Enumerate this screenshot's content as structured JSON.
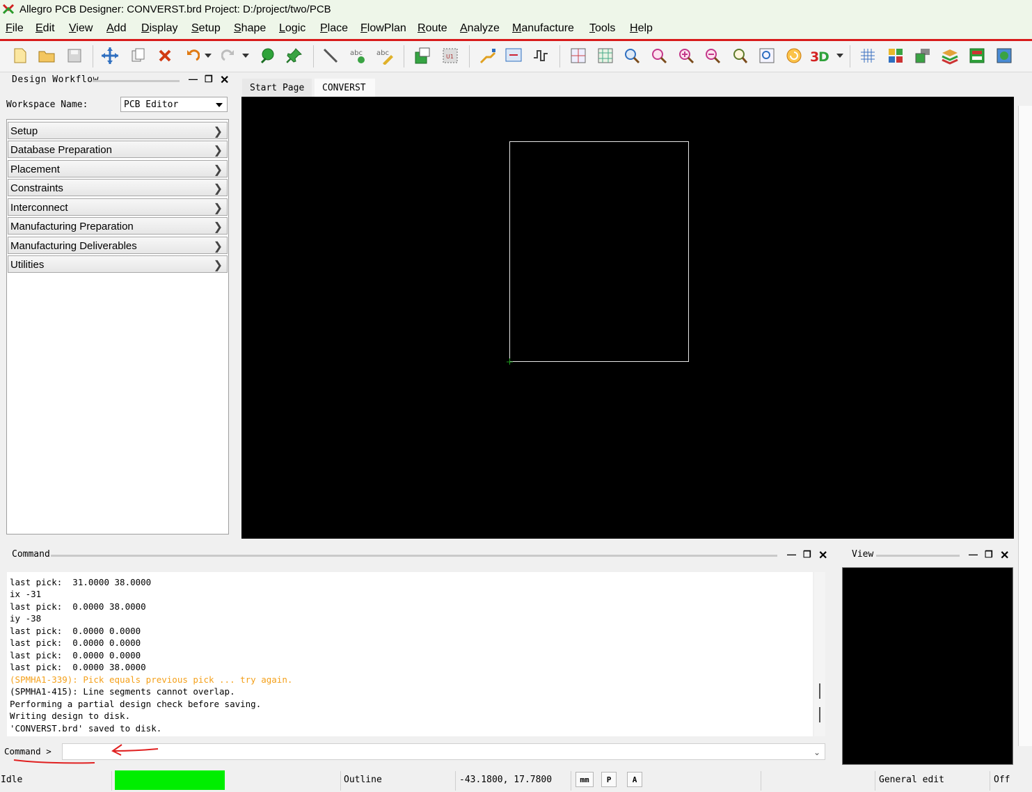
{
  "window": {
    "title": "Allegro PCB Designer: CONVERST.brd  Project: D:/project/two/PCB"
  },
  "menu": [
    "File",
    "Edit",
    "View",
    "Add",
    "Display",
    "Setup",
    "Shape",
    "Logic",
    "Place",
    "FlowPlan",
    "Route",
    "Analyze",
    "Manufacture",
    "Tools",
    "Help"
  ],
  "workflow": {
    "title": "Design Workflow",
    "workspace_label": "Workspace Name:",
    "workspace_value": "PCB Editor",
    "items": [
      "Setup",
      "Database Preparation",
      "Placement",
      "Constraints",
      "Interconnect",
      "Manufacturing Preparation",
      "Manufacturing Deliverables",
      "Utilities"
    ]
  },
  "tabs": [
    "Start Page",
    "CONVERST"
  ],
  "command": {
    "title": "Command",
    "lines": [
      {
        "text": "last pick:  31.0000 38.0000",
        "type": "normal"
      },
      {
        "text": "ix -31",
        "type": "normal"
      },
      {
        "text": "last pick:  0.0000 38.0000",
        "type": "normal"
      },
      {
        "text": "iy -38",
        "type": "normal"
      },
      {
        "text": "last pick:  0.0000 0.0000",
        "type": "normal"
      },
      {
        "text": "last pick:  0.0000 0.0000",
        "type": "normal"
      },
      {
        "text": "last pick:  0.0000 0.0000",
        "type": "normal"
      },
      {
        "text": "last pick:  0.0000 38.0000",
        "type": "normal"
      },
      {
        "text": "(SPMHA1-339): Pick equals previous pick ... try again.",
        "type": "warning"
      },
      {
        "text": "(SPMHA1-415): Line segments cannot overlap.",
        "type": "normal"
      },
      {
        "text": "Performing a partial design check before saving.",
        "type": "normal"
      },
      {
        "text": "Writing design to disk.",
        "type": "normal"
      },
      {
        "text": "'CONVERST.brd' saved to disk.",
        "type": "normal"
      }
    ],
    "prompt": "Command >",
    "input_value": ""
  },
  "view": {
    "title": "View"
  },
  "status": {
    "state": "Idle",
    "layer": "Outline",
    "coords": "-43.1800, 17.7800",
    "unit": "mm",
    "p_label": "P",
    "a_label": "A",
    "mode": "General edit",
    "toggle": "Off"
  },
  "colors": {
    "menu_underline": "#d81b1b",
    "progress": "#00ee00",
    "warning_text": "#f4a01a",
    "outline": "#e8e8e8"
  }
}
